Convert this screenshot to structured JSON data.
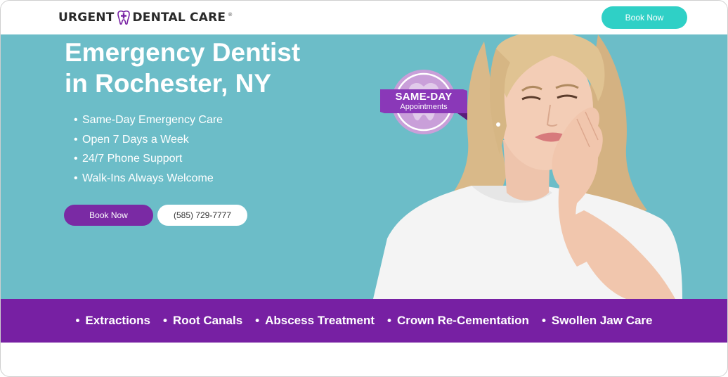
{
  "header": {
    "logo_left": "URGENT",
    "logo_right": "DENTAL CARE",
    "logo_tm": "®",
    "book_label": "Book Now"
  },
  "hero": {
    "title_line1": "Emergency Dentist",
    "title_line2": "in Rochester, NY",
    "bullets": [
      "Same-Day Emergency Care",
      "Open 7 Days a Week",
      "24/7 Phone Support",
      "Walk-Ins Always Welcome"
    ],
    "book_label": "Book Now",
    "phone_label": "(585) 729-7777"
  },
  "badge": {
    "line1": "SAME-DAY",
    "line2": "Appointments"
  },
  "services": [
    "Extractions",
    "Root Canals",
    "Abscess Treatment",
    "Crown Re-Cementation",
    "Swollen Jaw Care"
  ],
  "colors": {
    "teal_button": "#2fd0c6",
    "hero_bg": "#6cbdc8",
    "purple": "#7720a3",
    "book_purple": "#7a2aa4"
  },
  "icons": {
    "logo": "tooth-plus-icon",
    "bullet": "bullet-dot"
  }
}
